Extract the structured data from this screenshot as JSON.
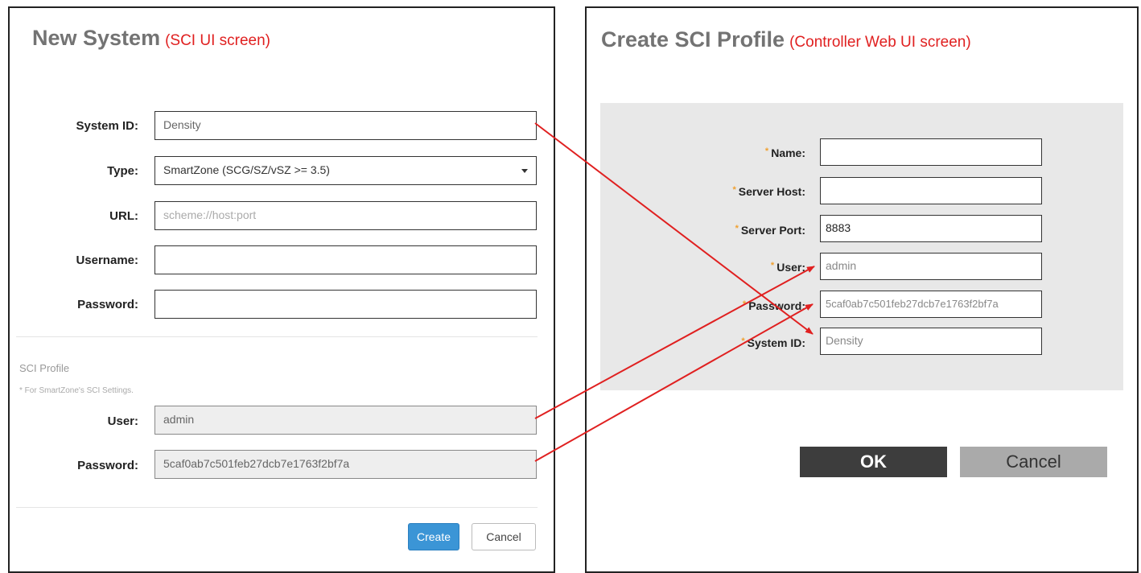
{
  "left": {
    "title": "New System",
    "subtitle": "(SCI UI screen)",
    "fields": {
      "system_id": {
        "label": "System ID:",
        "value": "Density"
      },
      "type": {
        "label": "Type:",
        "value": "SmartZone (SCG/SZ/vSZ >= 3.5)"
      },
      "url": {
        "label": "URL:",
        "placeholder": "scheme://host:port"
      },
      "username": {
        "label": "Username:",
        "value": ""
      },
      "password": {
        "label": "Password:",
        "value": ""
      }
    },
    "sci_profile": {
      "heading": "SCI Profile",
      "note": "* For SmartZone's SCI Settings.",
      "user": {
        "label": "User:",
        "value": "admin"
      },
      "password": {
        "label": "Password:",
        "value": "5caf0ab7c501feb27dcb7e1763f2bf7a"
      }
    },
    "buttons": {
      "create": "Create",
      "cancel": "Cancel"
    }
  },
  "right": {
    "title": "Create SCI Profile",
    "subtitle": "(Controller Web UI screen)",
    "required_marker": "*",
    "fields": {
      "name": {
        "label": "Name:",
        "value": ""
      },
      "server_host": {
        "label": "Server Host:",
        "value": ""
      },
      "server_port": {
        "label": "Server Port:",
        "value": "8883"
      },
      "user": {
        "label": "User:",
        "value": "admin"
      },
      "password": {
        "label": "Password:",
        "value": "5caf0ab7c501feb27dcb7e1763f2bf7a"
      },
      "system_id": {
        "label": "System ID:",
        "value": "Density"
      }
    },
    "buttons": {
      "ok": "OK",
      "cancel": "Cancel"
    }
  },
  "colors": {
    "annotation_red": "#e02020",
    "create_blue": "#3b95d6",
    "ok_dark": "#3d3d3d",
    "cancel_gray": "#aaaaaa",
    "required_orange": "#f0a030"
  }
}
